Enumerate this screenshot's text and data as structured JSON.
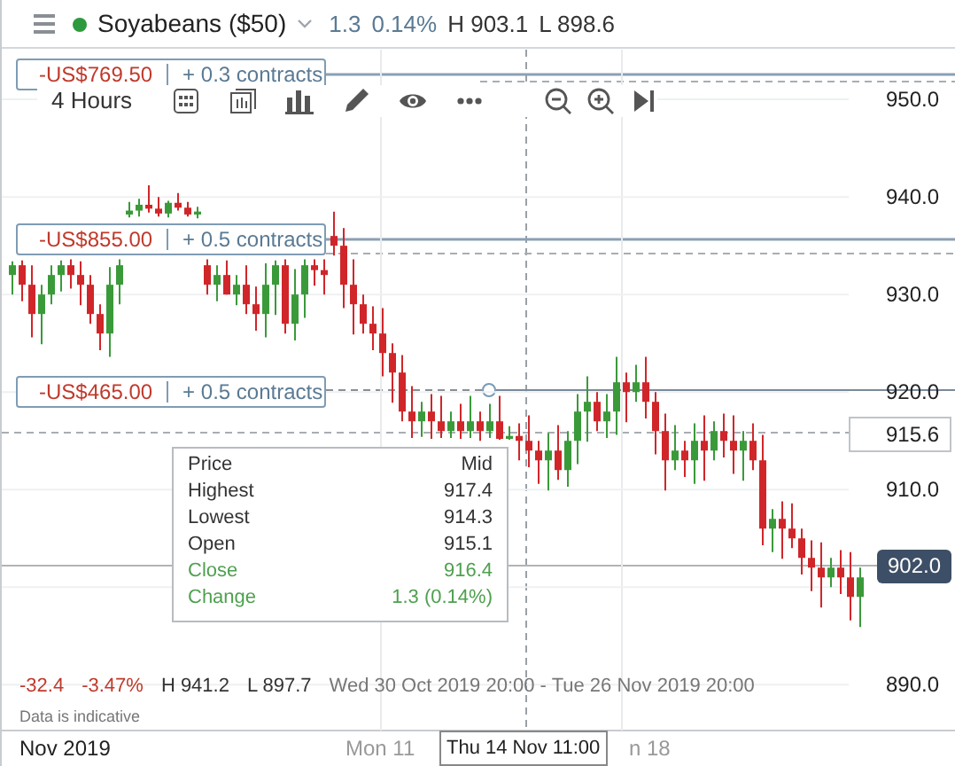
{
  "header": {
    "instrument": "Soyabeans ($50)",
    "change": "1.3",
    "change_pct": "0.14%",
    "high": "H 903.1",
    "low": "L 898.6"
  },
  "toolbar": {
    "interval": "4 Hours"
  },
  "positions": [
    {
      "pnl": "-US$769.50",
      "size": "+ 0.3 contracts"
    },
    {
      "pnl": "-US$855.00",
      "size": "+ 0.5 contracts"
    },
    {
      "pnl": "-US$465.00",
      "size": "+ 0.5 contracts"
    }
  ],
  "chart": {
    "chart_data": {
      "type": "candlestick",
      "ylim": [
        885.3,
        955.1
      ],
      "yticks": [
        {
          "value": 950,
          "label": "950.0"
        },
        {
          "value": 940,
          "label": "940.0"
        },
        {
          "value": 930,
          "label": "930.0"
        },
        {
          "value": 920,
          "label": "920.0"
        },
        {
          "value": 910,
          "label": "910.0"
        },
        {
          "value": 890,
          "label": "890.0"
        }
      ],
      "grid": true,
      "ohlc": [
        [
          932,
          933.4,
          930,
          933
        ],
        [
          933,
          933.5,
          929.3,
          931
        ],
        [
          931,
          933,
          925.6,
          928
        ],
        [
          928,
          931,
          924.9,
          930
        ],
        [
          930,
          933,
          929,
          932
        ],
        [
          932,
          933.5,
          930.3,
          933
        ],
        [
          933,
          933.6,
          930.6,
          932
        ],
        [
          932,
          933.4,
          928.9,
          931
        ],
        [
          931,
          932,
          927,
          928
        ],
        [
          928,
          929,
          924.3,
          926
        ],
        [
          926,
          932.8,
          923.6,
          931
        ],
        [
          931,
          933.6,
          929,
          933
        ],
        [
          938.2,
          939.5,
          937.9,
          938.6
        ],
        [
          938.6,
          939.8,
          938,
          939.2
        ],
        [
          939.2,
          941.2,
          938.4,
          938.8
        ],
        [
          938.8,
          940,
          938,
          938.3
        ],
        [
          938.3,
          939.6,
          937.9,
          939.4
        ],
        [
          939.4,
          940.4,
          938.6,
          938.9
        ],
        [
          938.9,
          939.5,
          938,
          938.2
        ],
        [
          938.2,
          939,
          937.8,
          938.5
        ],
        [
          933,
          933.6,
          930,
          931
        ],
        [
          931,
          933,
          929.3,
          932
        ],
        [
          932,
          933.5,
          930,
          930
        ],
        [
          930,
          932,
          928.9,
          931
        ],
        [
          931,
          933,
          928,
          929
        ],
        [
          929,
          930.8,
          926.3,
          928
        ],
        [
          928,
          933.2,
          925.6,
          931
        ],
        [
          931,
          933.5,
          927.9,
          933
        ],
        [
          933,
          933.6,
          926,
          927
        ],
        [
          927,
          932.6,
          925.3,
          930
        ],
        [
          930,
          933.6,
          927.6,
          933
        ],
        [
          933,
          933.6,
          930.9,
          932.5
        ],
        [
          932.5,
          933.6,
          930,
          932
        ],
        [
          936,
          938.5,
          934,
          935
        ],
        [
          935,
          936.8,
          928.6,
          931
        ],
        [
          931,
          933.6,
          925.9,
          929
        ],
        [
          929,
          930,
          926,
          927
        ],
        [
          927,
          928.8,
          924.3,
          926
        ],
        [
          926,
          928.6,
          921.6,
          924
        ],
        [
          924,
          925,
          918.9,
          922
        ],
        [
          922,
          923.8,
          917,
          918
        ],
        [
          918,
          920.6,
          915.3,
          917
        ],
        [
          917,
          919,
          915.4,
          918
        ],
        [
          918,
          919.8,
          915.2,
          917
        ],
        [
          917,
          919.6,
          915.3,
          916
        ],
        [
          916,
          918,
          915.3,
          917
        ],
        [
          917,
          918.8,
          915.2,
          916
        ],
        [
          916,
          919.6,
          915.3,
          917
        ],
        [
          917,
          918,
          915,
          916
        ],
        [
          916,
          918.8,
          915.3,
          917
        ],
        [
          917,
          919.6,
          915.1,
          915.2
        ],
        [
          915.2,
          916.5,
          915.1,
          915.5
        ],
        [
          915.5,
          916.8,
          913,
          915
        ],
        [
          915,
          917.6,
          912.3,
          914
        ],
        [
          914,
          915,
          910.6,
          913
        ],
        [
          913,
          915.8,
          909.9,
          914
        ],
        [
          914,
          916.6,
          911,
          912
        ],
        [
          912,
          916,
          910.3,
          915
        ],
        [
          915,
          919.8,
          912.6,
          918
        ],
        [
          918,
          921.6,
          914.9,
          919
        ],
        [
          919,
          920,
          916,
          917
        ],
        [
          917,
          919.8,
          915.3,
          918
        ],
        [
          918,
          923.6,
          915.6,
          921
        ],
        [
          921,
          922,
          916.9,
          920
        ],
        [
          920,
          922.8,
          919,
          921
        ],
        [
          921,
          923.6,
          917.3,
          919
        ],
        [
          919,
          920,
          913.6,
          916
        ],
        [
          916,
          917.8,
          909.9,
          913
        ],
        [
          913,
          916.6,
          912,
          914
        ],
        [
          914,
          915,
          911.3,
          913
        ],
        [
          913,
          916.8,
          910.6,
          915
        ],
        [
          915,
          917.6,
          910.9,
          914
        ],
        [
          914,
          917,
          913,
          916
        ],
        [
          916,
          917.8,
          913.3,
          915
        ],
        [
          915,
          917.6,
          911.6,
          914
        ],
        [
          914,
          916,
          910.9,
          915
        ],
        [
          915,
          916.8,
          912,
          913
        ],
        [
          913,
          915.6,
          904.3,
          906
        ],
        [
          906,
          908,
          903.6,
          907
        ],
        [
          907,
          908.8,
          902.9,
          906
        ],
        [
          906,
          908.6,
          904,
          905
        ],
        [
          905,
          906,
          901.3,
          903
        ],
        [
          903,
          904.8,
          899.6,
          902
        ],
        [
          902,
          904.6,
          897.9,
          901
        ],
        [
          901,
          903,
          900,
          902
        ],
        [
          902,
          903.8,
          899.3,
          901
        ],
        [
          901,
          903.6,
          896.6,
          899
        ],
        [
          899,
          902,
          895.9,
          901
        ]
      ]
    }
  },
  "crosshair_price": "915.6",
  "last_price": "902.0",
  "tooltip": {
    "title": "Price",
    "mode": "Mid",
    "rows": [
      {
        "label": "Highest",
        "value": "917.4",
        "kind": "plain"
      },
      {
        "label": "Lowest",
        "value": "914.3",
        "kind": "plain"
      },
      {
        "label": "Open",
        "value": "915.1",
        "kind": "plain"
      },
      {
        "label": "Close",
        "value": "916.4",
        "kind": "positive"
      },
      {
        "label": "Change",
        "value": "1.3 (0.14%)",
        "kind": "positive"
      }
    ]
  },
  "summary": {
    "change": "-32.4",
    "change_pct": "-3.47%",
    "high": "H 941.2",
    "low": "L 897.7",
    "range": "Wed 30 Oct 2019 20:00 - Tue 26 Nov 2019 20:00"
  },
  "note": "Data is indicative",
  "time_axis": {
    "month": "Nov 2019",
    "labels": [
      "Mon 11"
    ],
    "crosshair_time": "Thu 14 Nov 11:00",
    "partial_label": "n 18"
  }
}
